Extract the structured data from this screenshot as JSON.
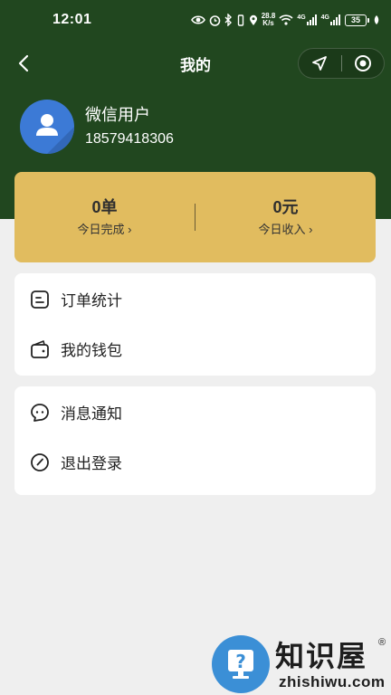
{
  "status_bar": {
    "time": "12:01",
    "net_speed_value": "28.8",
    "net_speed_unit": "K/s",
    "signal1_label": "4G",
    "signal2_label": "4G",
    "battery": "35"
  },
  "nav": {
    "title": "我的"
  },
  "profile": {
    "name": "微信用户",
    "phone": "18579418306"
  },
  "stats": [
    {
      "value": "0单",
      "label": "今日完成 ›"
    },
    {
      "value": "0元",
      "label": "今日收入 ›"
    }
  ],
  "menu_group1": [
    {
      "label": "订单统计",
      "icon": "order-list-icon"
    },
    {
      "label": "我的钱包",
      "icon": "wallet-icon"
    }
  ],
  "menu_group2": [
    {
      "label": "消息通知",
      "icon": "message-icon"
    },
    {
      "label": "退出登录",
      "icon": "logout-icon"
    }
  ],
  "watermark": {
    "brand": "知识屋",
    "reg_mark": "®",
    "domain": "zhishiwu.com"
  },
  "colors": {
    "header_green": "#21471f",
    "stats_gold": "#e1bc5f",
    "avatar_blue": "#3c7ad6",
    "page_bg": "#efefef"
  }
}
